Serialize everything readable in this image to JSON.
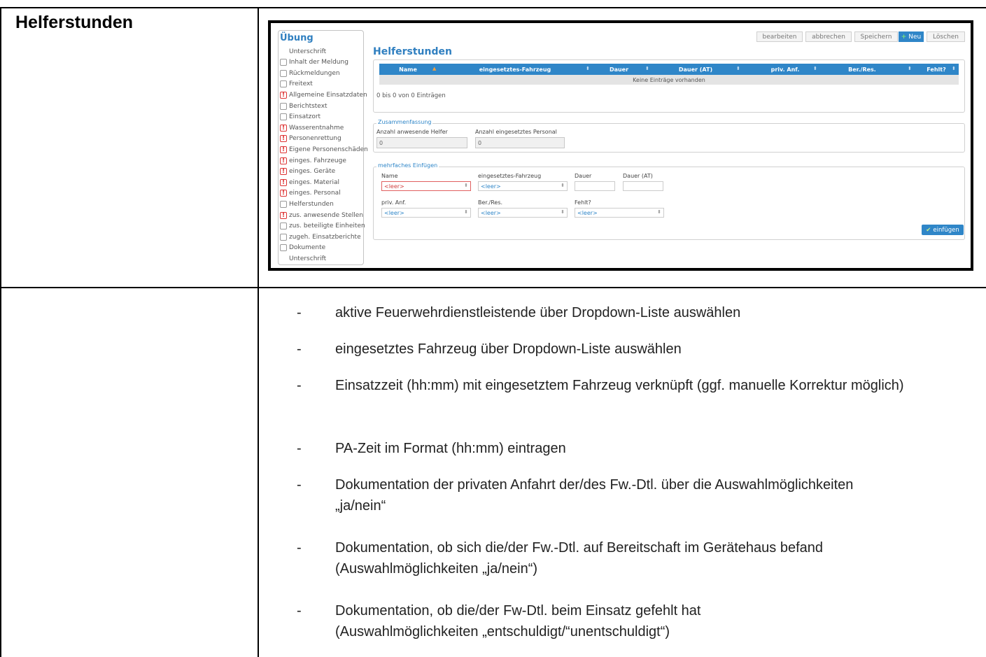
{
  "section_title": "Helferstunden",
  "toolbar": {
    "edit": "bearbeiten",
    "cancel": "abbrechen",
    "save": "Speichern",
    "new": "Neu",
    "delete": "Löschen"
  },
  "sidebar": {
    "title": "Übung",
    "items": [
      {
        "label": "Unterschrift",
        "state": "none"
      },
      {
        "label": "Inhalt der Meldung",
        "state": "box"
      },
      {
        "label": "Rückmeldungen",
        "state": "box"
      },
      {
        "label": "Freitext",
        "state": "box"
      },
      {
        "label": "Allgemeine Einsatzdaten",
        "state": "warn"
      },
      {
        "label": "Berichtstext",
        "state": "box"
      },
      {
        "label": "Einsatzort",
        "state": "box"
      },
      {
        "label": "Wasserentnahme",
        "state": "warn"
      },
      {
        "label": "Personenrettung",
        "state": "warn"
      },
      {
        "label": "Eigene Personenschäden",
        "state": "warn"
      },
      {
        "label": "einges. Fahrzeuge",
        "state": "warn"
      },
      {
        "label": "einges. Geräte",
        "state": "warn"
      },
      {
        "label": "einges. Material",
        "state": "warn"
      },
      {
        "label": "einges. Personal",
        "state": "warn"
      },
      {
        "label": "Helferstunden",
        "state": "box"
      },
      {
        "label": "zus. anwesende Stellen",
        "state": "warn"
      },
      {
        "label": "zus. beteiligte Einheiten",
        "state": "box"
      },
      {
        "label": "zugeh. Einsatzberichte",
        "state": "box"
      },
      {
        "label": "Dokumente",
        "state": "box"
      },
      {
        "label": "Unterschrift",
        "state": "none"
      }
    ]
  },
  "main": {
    "title": "Helferstunden",
    "grid": {
      "columns": [
        "Name",
        "eingesetztes-Fahrzeug",
        "Dauer",
        "Dauer (AT)",
        "priv. Anf.",
        "Ber./Res.",
        "Fehlt?"
      ],
      "empty_text": "Keine Einträge vorhanden",
      "info": "0 bis 0 von 0 Einträgen"
    },
    "summary": {
      "legend": "Zusammenfassung",
      "helpers_label": "Anzahl anwesende Helfer",
      "helpers_value": "0",
      "personnel_label": "Anzahl eingesetztes Personal",
      "personnel_value": "0"
    },
    "multi_insert": {
      "legend": "mehrfaches Einfügen",
      "name_label": "Name",
      "vehicle_label": "eingesetztes-Fahrzeug",
      "duration_label": "Dauer",
      "duration_at_label": "Dauer (AT)",
      "priv_label": "priv. Anf.",
      "ber_label": "Ber./Res.",
      "fehlt_label": "Fehlt?",
      "empty_option": "<leer>",
      "insert_button": "einfügen"
    }
  },
  "bullets": [
    "aktive Feuerwehrdienstleistende über Dropdown-Liste auswählen",
    "eingesetztes Fahrzeug über Dropdown-Liste auswählen",
    "Einsatzzeit (hh:mm) mit eingesetztem Fahrzeug verknüpft (ggf. manuelle Korrektur möglich)",
    "PA-Zeit im Format (hh:mm) eintragen",
    "Dokumentation der privaten Anfahrt der/des Fw.-Dtl. über die Auswahlmöglichkeiten „ja/nein“",
    "Dokumentation, ob sich die/der Fw.-Dtl. auf Bereitschaft im Gerätehaus befand (Auswahlmöglichkeiten „ja/nein“)",
    "Dokumentation, ob die/der Fw-Dtl. beim Einsatz gefehlt hat (Auswahlmöglichkeiten „entschuldigt/“unentschuldigt“)"
  ],
  "bullet_dash": "-"
}
